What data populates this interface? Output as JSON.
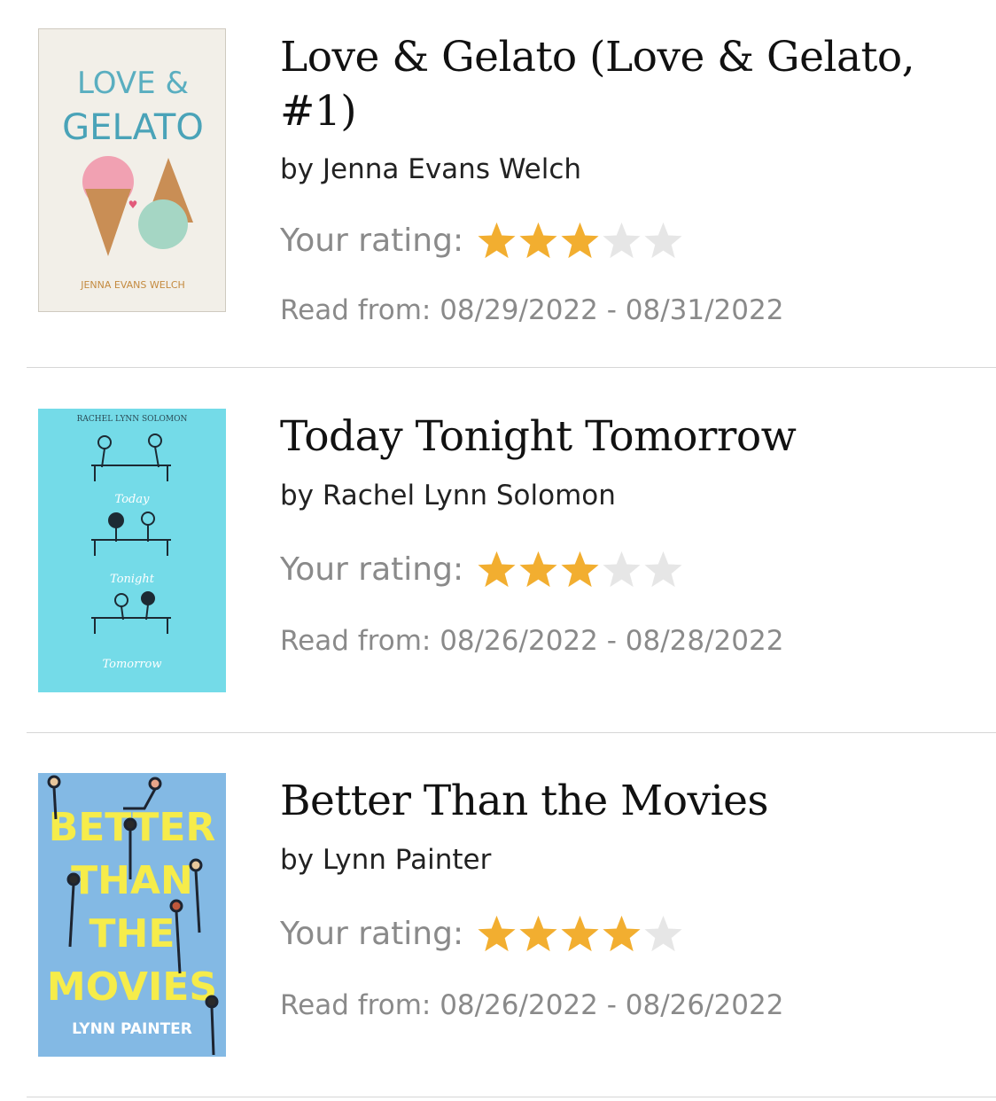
{
  "colors": {
    "star_filled": "#f2ae30",
    "star_empty": "#e6e6e6",
    "divider": "#d6d6d6"
  },
  "books": [
    {
      "title": "Love & Gelato (Love & Gelato, #1)",
      "author": "by Jenna Evans Welch",
      "rating_label": "Your rating:",
      "rating": 3,
      "max_rating": 5,
      "read_dates": "Read from: 08/29/2022 - 08/31/2022",
      "cover": {
        "title_line1": "LOVE &",
        "title_line2": "GELATO",
        "author": "JENNA EVANS WELCH",
        "background": "#f2efe8"
      }
    },
    {
      "title": "Today Tonight Tomorrow",
      "author": "by Rachel Lynn Solomon",
      "rating_label": "Your rating:",
      "rating": 3,
      "max_rating": 5,
      "read_dates": "Read from: 08/26/2022 - 08/28/2022",
      "cover": {
        "author": "RACHEL LYNN SOLOMON",
        "word1": "Today",
        "word2": "Tonight",
        "word3": "Tomorrow",
        "background": "#74dbe8"
      }
    },
    {
      "title": "Better Than the Movies",
      "author": "by Lynn Painter",
      "rating_label": "Your rating:",
      "rating": 4,
      "max_rating": 5,
      "read_dates": "Read from: 08/26/2022 - 08/26/2022",
      "cover": {
        "line1": "BETTER",
        "line2": "THAN",
        "line3": "THE",
        "line4": "MOVIES",
        "author": "LYNN PAINTER",
        "background": "#83b9e4"
      }
    }
  ]
}
